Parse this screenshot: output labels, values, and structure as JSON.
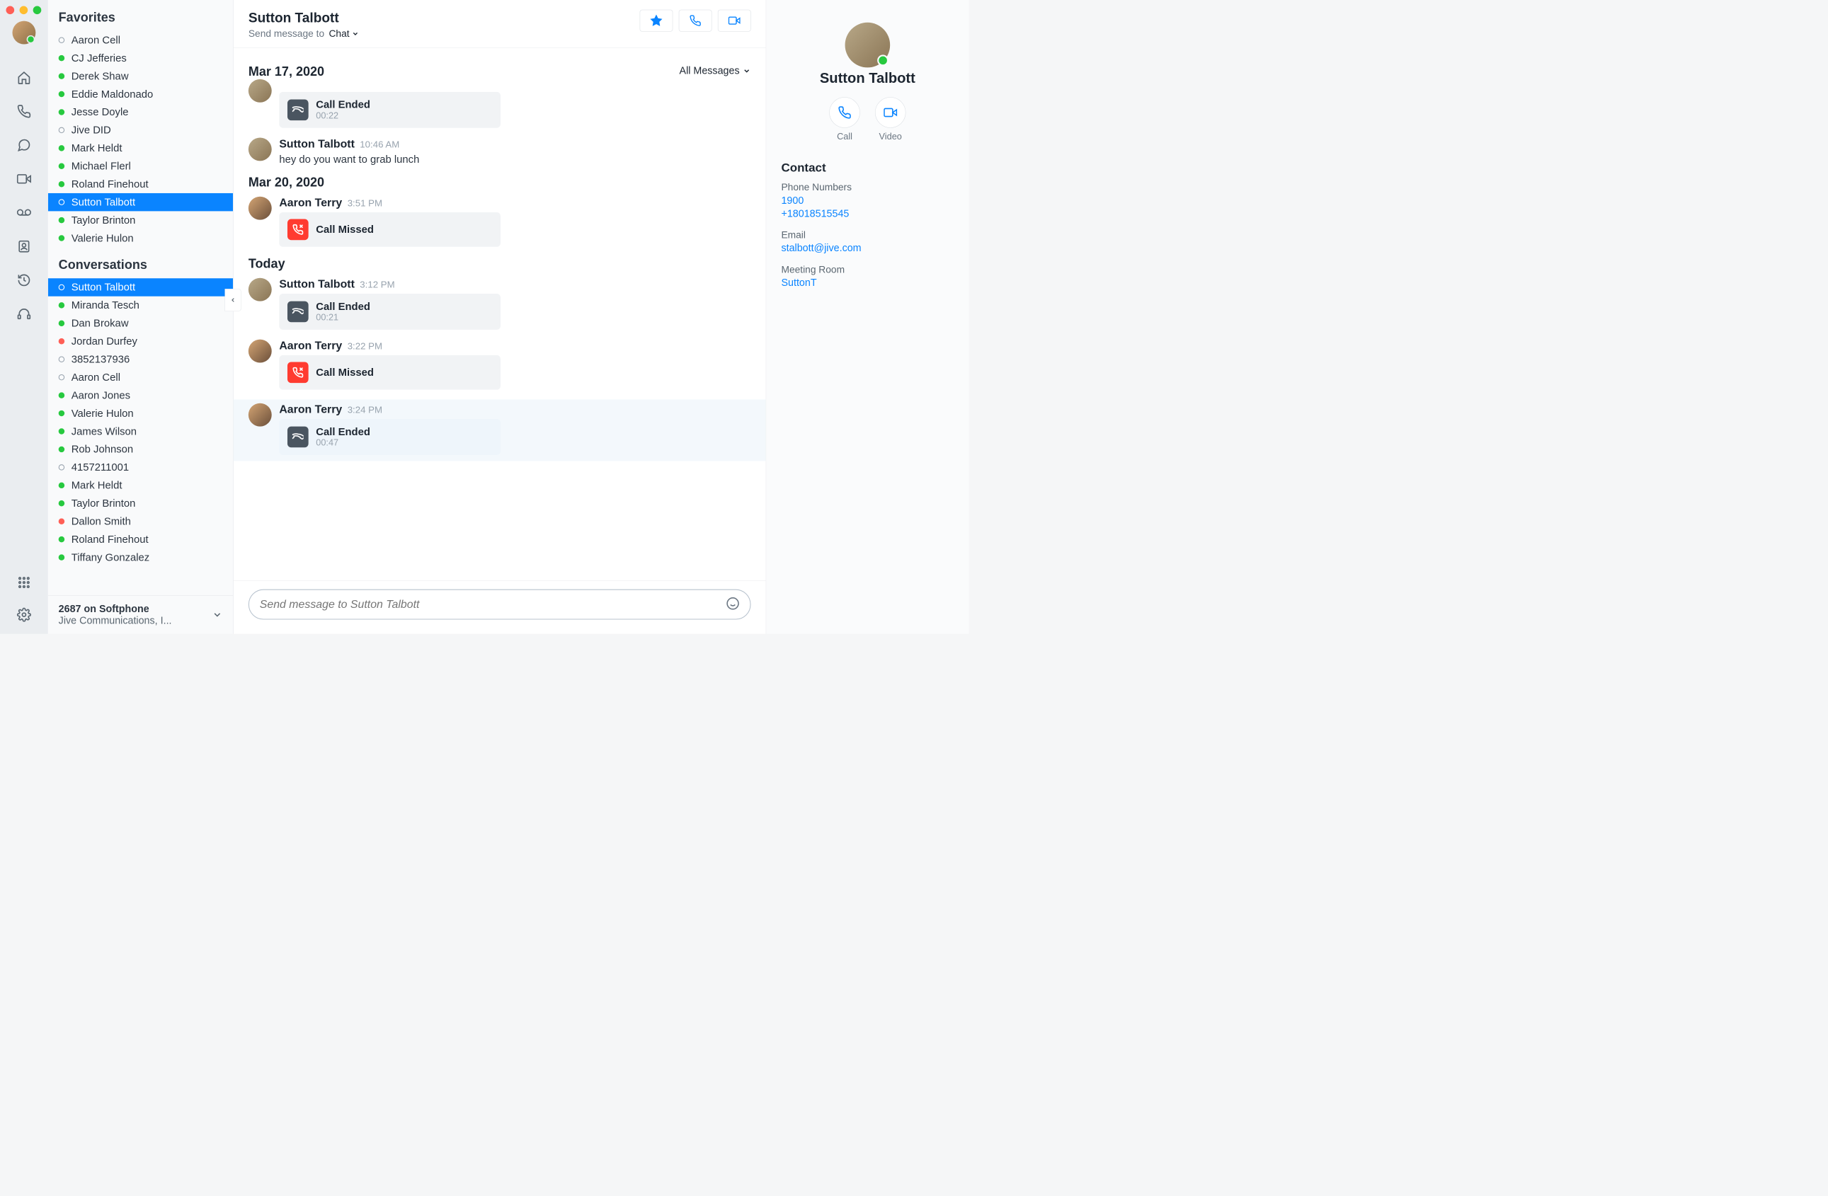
{
  "header": {
    "contact_name": "Sutton Talbott",
    "send_to_label": "Send message to",
    "send_mode": "Chat",
    "filter_label": "All Messages"
  },
  "sidebar": {
    "favorites_title": "Favorites",
    "conversations_title": "Conversations",
    "favorites": [
      {
        "name": "Aaron Cell",
        "status": "hollow",
        "selected": false
      },
      {
        "name": "CJ Jefferies",
        "status": "green",
        "selected": false
      },
      {
        "name": "Derek Shaw",
        "status": "green",
        "selected": false
      },
      {
        "name": "Eddie Maldonado",
        "status": "green",
        "selected": false
      },
      {
        "name": "Jesse Doyle",
        "status": "green",
        "selected": false
      },
      {
        "name": "Jive DID",
        "status": "hollow",
        "selected": false
      },
      {
        "name": "Mark Heldt",
        "status": "green",
        "selected": false
      },
      {
        "name": "Michael Flerl",
        "status": "green",
        "selected": false
      },
      {
        "name": "Roland Finehout",
        "status": "green",
        "selected": false
      },
      {
        "name": "Sutton Talbott",
        "status": "hollow",
        "selected": true
      },
      {
        "name": "Taylor Brinton",
        "status": "green",
        "selected": false
      },
      {
        "name": "Valerie Hulon",
        "status": "green",
        "selected": false
      }
    ],
    "conversations": [
      {
        "name": "Sutton Talbott",
        "status": "hollow",
        "selected": true
      },
      {
        "name": "Miranda Tesch",
        "status": "green",
        "selected": false
      },
      {
        "name": "Dan Brokaw",
        "status": "green",
        "selected": false
      },
      {
        "name": "Jordan Durfey",
        "status": "red",
        "selected": false
      },
      {
        "name": "3852137936",
        "status": "hollow",
        "selected": false
      },
      {
        "name": "Aaron Cell",
        "status": "hollow",
        "selected": false
      },
      {
        "name": "Aaron Jones",
        "status": "green",
        "selected": false
      },
      {
        "name": "Valerie Hulon",
        "status": "green",
        "selected": false
      },
      {
        "name": "James Wilson",
        "status": "green",
        "selected": false
      },
      {
        "name": "Rob Johnson",
        "status": "green",
        "selected": false
      },
      {
        "name": "4157211001",
        "status": "hollow",
        "selected": false
      },
      {
        "name": "Mark Heldt",
        "status": "green",
        "selected": false
      },
      {
        "name": "Taylor Brinton",
        "status": "green",
        "selected": false
      },
      {
        "name": "Dallon Smith",
        "status": "red",
        "selected": false
      },
      {
        "name": "Roland Finehout",
        "status": "green",
        "selected": false
      },
      {
        "name": "Tiffany Gonzalez",
        "status": "green",
        "selected": false
      }
    ],
    "footer": {
      "title": "2687 on Softphone",
      "sub": "Jive Communications, I..."
    }
  },
  "messages": {
    "groups": [
      {
        "date": "Mar 17, 2020",
        "items": [
          {
            "kind": "call",
            "sender": "",
            "time": "",
            "avatar": "crowd",
            "call_type": "ended",
            "title": "Call Ended",
            "sub": "00:22",
            "partial": true
          },
          {
            "kind": "text",
            "sender": "Sutton Talbott",
            "time": "10:46 AM",
            "avatar": "crowd",
            "text": "hey do you want to grab lunch"
          }
        ]
      },
      {
        "date": "Mar 20, 2020",
        "items": [
          {
            "kind": "call",
            "sender": "Aaron Terry",
            "time": "3:51 PM",
            "avatar": "person",
            "call_type": "missed",
            "title": "Call Missed",
            "sub": ""
          }
        ]
      },
      {
        "date": "Today",
        "items": [
          {
            "kind": "call",
            "sender": "Sutton Talbott",
            "time": "3:12 PM",
            "avatar": "crowd",
            "call_type": "ended",
            "title": "Call Ended",
            "sub": "00:21"
          },
          {
            "kind": "call",
            "sender": "Aaron Terry",
            "time": "3:22 PM",
            "avatar": "person",
            "call_type": "missed",
            "title": "Call Missed",
            "sub": ""
          },
          {
            "kind": "call",
            "sender": "Aaron Terry",
            "time": "3:24 PM",
            "avatar": "person",
            "call_type": "ended",
            "title": "Call Ended",
            "sub": "00:47",
            "hover": true
          }
        ]
      }
    ]
  },
  "composer": {
    "placeholder": "Send message to Sutton Talbott"
  },
  "details": {
    "name": "Sutton Talbott",
    "call_label": "Call",
    "video_label": "Video",
    "contact_title": "Contact",
    "phone_label": "Phone Numbers",
    "phones": [
      "1900",
      "+18018515545"
    ],
    "email_label": "Email",
    "email": "stalbott@jive.com",
    "meeting_label": "Meeting Room",
    "meeting": "SuttonT"
  }
}
